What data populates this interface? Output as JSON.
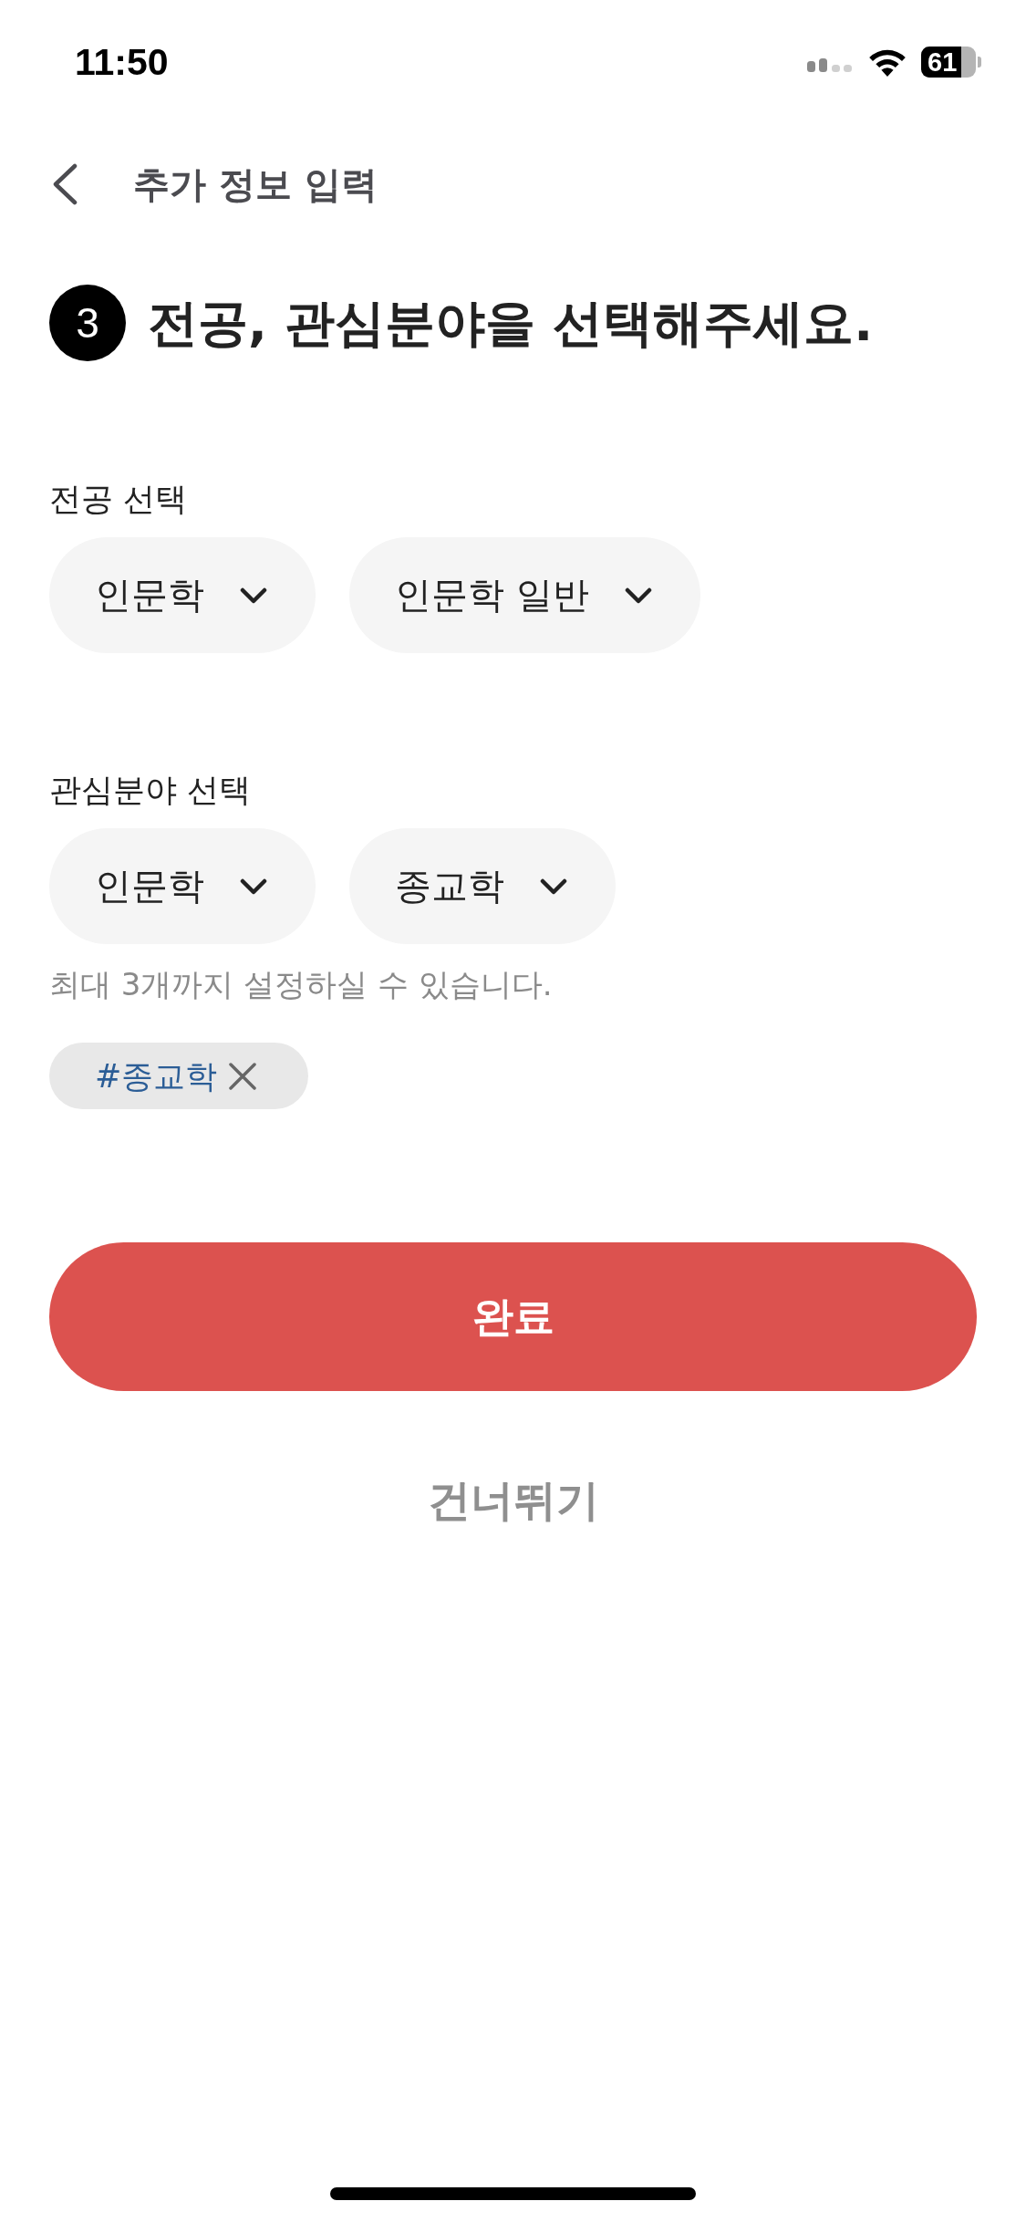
{
  "status_bar": {
    "time": "11:50",
    "battery": "61"
  },
  "header": {
    "title": "추가 정보 입력"
  },
  "step": {
    "number": "3",
    "title": "전공, 관심분야을 선택해주세요."
  },
  "sections": [
    {
      "label": "전공 선택",
      "dropdowns": [
        "인문학",
        "인문학 일반"
      ]
    },
    {
      "label": "관심분야 선택",
      "dropdowns": [
        "인문학",
        "종교학"
      ],
      "hint": "최대 3개까지 설정하실 수 있습니다.",
      "tags": [
        "#종교학"
      ]
    }
  ],
  "primary_button": "완료",
  "skip_link": "건너뛰기"
}
